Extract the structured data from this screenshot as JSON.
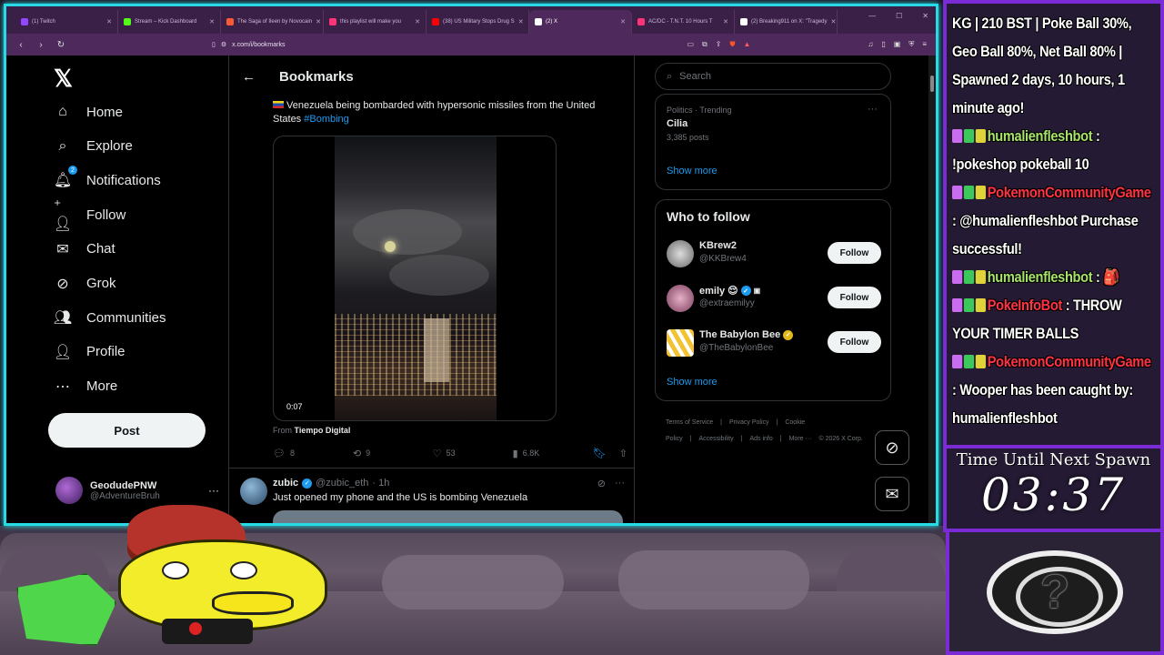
{
  "browser": {
    "tabs": [
      {
        "title": "(1) Twitch",
        "color": "#9146ff"
      },
      {
        "title": "Stream – Kick Dashboard",
        "color": "#53fc18"
      },
      {
        "title": "The Saga of Ileen by Novocain",
        "color": "#ff5a36"
      },
      {
        "title": "this playlist will make you",
        "color": "#ff3377"
      },
      {
        "title": "(38) US Military Stops Drug S",
        "color": "#ff0000"
      },
      {
        "title": "(2) X",
        "color": "#ffffff"
      },
      {
        "title": "AC/DC - T.N.T. 10 Hours T",
        "color": "#ff3377"
      },
      {
        "title": "(2) Breaking911 on X: \"Tragedy",
        "color": "#ffffff"
      }
    ],
    "active_tab_index": 5,
    "url": "x.com/i/bookmarks"
  },
  "x": {
    "logo": "𝕏",
    "nav": [
      {
        "label": "Home",
        "icon": "home-icon",
        "glyph": "⌂"
      },
      {
        "label": "Explore",
        "icon": "search-icon",
        "glyph": "⌕"
      },
      {
        "label": "Notifications",
        "icon": "bell-icon",
        "glyph": "🔔︎",
        "badge": "2"
      },
      {
        "label": "Follow",
        "icon": "follow-icon",
        "glyph": "⁺👤︎"
      },
      {
        "label": "Chat",
        "icon": "mail-icon",
        "glyph": "✉"
      },
      {
        "label": "Grok",
        "icon": "grok-icon",
        "glyph": "⊘"
      },
      {
        "label": "Communities",
        "icon": "communities-icon",
        "glyph": "👥︎"
      },
      {
        "label": "Profile",
        "icon": "profile-icon",
        "glyph": "👤︎"
      },
      {
        "label": "More",
        "icon": "more-icon",
        "glyph": "⋯"
      }
    ],
    "post_label": "Post",
    "account": {
      "name": "GeodudePNW",
      "handle": "@AdventureBruh"
    },
    "header_title": "Bookmarks",
    "tweet1": {
      "text": "Venezuela being bombarded with hypersonic missiles from the United States",
      "hashtag": "#Bombing",
      "duration": "0:07",
      "from_prefix": "From",
      "from_source": "Tiempo Digital",
      "replies": "8",
      "reposts": "9",
      "likes": "53",
      "views": "6.8K"
    },
    "tweet2": {
      "name": "zubic",
      "handle": "@zubic_eth",
      "time": "· 1h",
      "text": "Just opened my phone and the US is bombing Venezuela"
    },
    "search_placeholder": "Search",
    "trend": {
      "category": "Politics · Trending",
      "name": "Cilia",
      "count": "3,385 posts"
    },
    "show_more": "Show more",
    "who_title": "Who to follow",
    "who": [
      {
        "name": "KBrew2",
        "handle": "@KKBrew4",
        "verified": false
      },
      {
        "name": "emily",
        "handle": "@extraemilyy",
        "verified": "blue"
      },
      {
        "name": "The Babylon Bee",
        "handle": "@TheBabylonBee",
        "verified": "gold"
      }
    ],
    "follow_label": "Follow",
    "footer": [
      "Terms of Service",
      "|",
      "Privacy Policy",
      "|",
      "Cookie Policy",
      "|",
      "Accessibility",
      "|",
      "Ads info",
      "|",
      "More ···",
      "© 2026 X Corp."
    ]
  },
  "overlay": {
    "chat": [
      {
        "type": "system",
        "text": "KG | 210 BST | Poke Ball 30%, Geo Ball 80%, Net Ball 80% | Spawned 2 days, 10 hours, 1 minute ago!"
      },
      {
        "type": "msg",
        "user": "humalienfleshbot",
        "user_color": "green",
        "badges": 3,
        "text": "!pokeshop pokeball 10"
      },
      {
        "type": "msg",
        "user": "PokemonCommunityGame",
        "user_color": "red",
        "badges": 3,
        "text": "@humalienfleshbot Purchase successful!"
      },
      {
        "type": "msg",
        "user": "humalienfleshbot",
        "user_color": "green",
        "badges": 3,
        "text": "🎒"
      },
      {
        "type": "msg",
        "user": "PokeInfoBot",
        "user_color": "red",
        "badges": 3,
        "text": "THROW YOUR TIMER BALLS"
      },
      {
        "type": "msg",
        "user": "PokemonCommunityGame",
        "user_color": "red",
        "badges": 3,
        "text": "Wooper has been caught by: humalienfleshbot"
      }
    ],
    "timer_label": "Time Until Next Spawn",
    "timer_value": "03:37",
    "pokemon_placeholder": "?"
  }
}
